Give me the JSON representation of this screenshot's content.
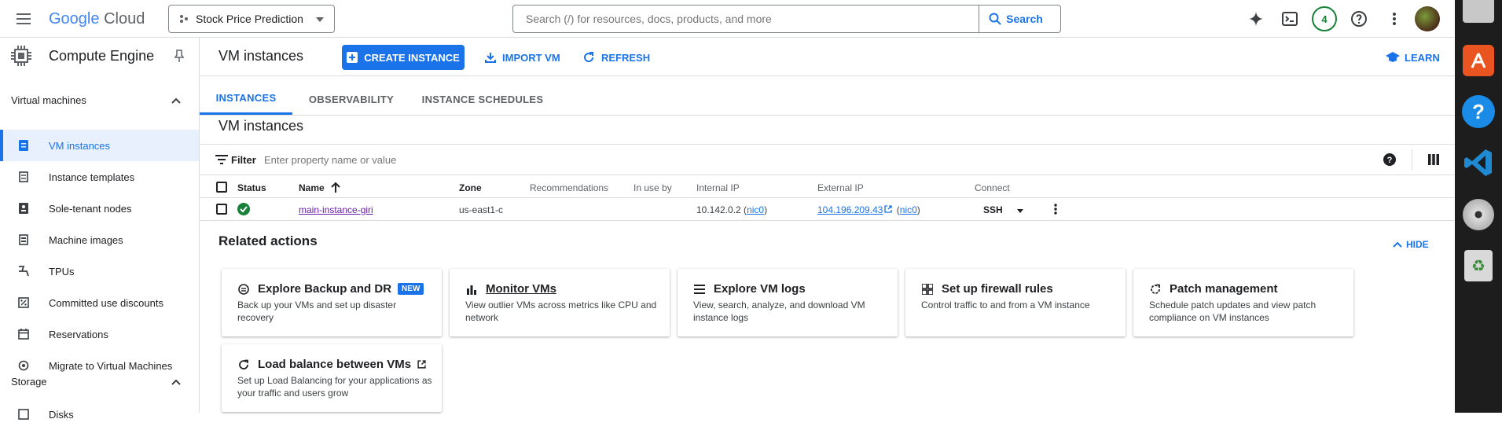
{
  "header": {
    "logo_google": "Google",
    "logo_cloud": "Cloud",
    "project": "Stock Price Prediction",
    "search_placeholder": "Search (/) for resources, docs, products, and more",
    "search_button": "Search",
    "notifications": "4"
  },
  "sidebar": {
    "product": "Compute Engine",
    "sections": [
      {
        "label": "Virtual machines"
      },
      {
        "label": "Storage"
      }
    ],
    "items": [
      {
        "label": "VM instances"
      },
      {
        "label": "Instance templates"
      },
      {
        "label": "Sole-tenant nodes"
      },
      {
        "label": "Machine images"
      },
      {
        "label": "TPUs"
      },
      {
        "label": "Committed use discounts"
      },
      {
        "label": "Reservations"
      },
      {
        "label": "Migrate to Virtual Machines"
      },
      {
        "label": "Disks"
      }
    ]
  },
  "page": {
    "title": "VM instances",
    "create_label": "CREATE INSTANCE",
    "import_label": "IMPORT VM",
    "refresh_label": "REFRESH",
    "learn_label": "LEARN",
    "tabs": [
      {
        "label": "INSTANCES"
      },
      {
        "label": "OBSERVABILITY"
      },
      {
        "label": "INSTANCE SCHEDULES"
      }
    ],
    "section_title": "VM instances",
    "filter_label": "Filter",
    "filter_placeholder": "Enter property name or value"
  },
  "table": {
    "columns": [
      "Status",
      "Name",
      "Zone",
      "Recommendations",
      "In use by",
      "Internal IP",
      "External IP",
      "Connect"
    ],
    "rows": [
      {
        "name": "main-instance-giri",
        "zone": "us-east1-c",
        "internal_ip": "10.142.0.2",
        "internal_nic": "nic0",
        "external_ip": "104.196.209.43",
        "external_nic": "nic0",
        "connect": "SSH"
      }
    ]
  },
  "related": {
    "title": "Related actions",
    "hide_label": "HIDE",
    "new_badge": "NEW",
    "cards": [
      {
        "title": "Explore Backup and DR",
        "desc": "Back up your VMs and set up disaster recovery"
      },
      {
        "title": "Monitor VMs",
        "desc": "View outlier VMs across metrics like CPU and network"
      },
      {
        "title": "Explore VM logs",
        "desc": "View, search, analyze, and download VM instance logs"
      },
      {
        "title": "Set up firewall rules",
        "desc": "Control traffic to and from a VM instance"
      },
      {
        "title": "Patch management",
        "desc": "Schedule patch updates and view patch compliance on VM instances"
      },
      {
        "title": "Load balance between VMs",
        "desc": "Set up Load Balancing for your applications as your traffic and users grow"
      }
    ]
  },
  "colors": {
    "accent": "#1a73e8",
    "status_ok": "#188038",
    "link_visited": "#681da8"
  }
}
